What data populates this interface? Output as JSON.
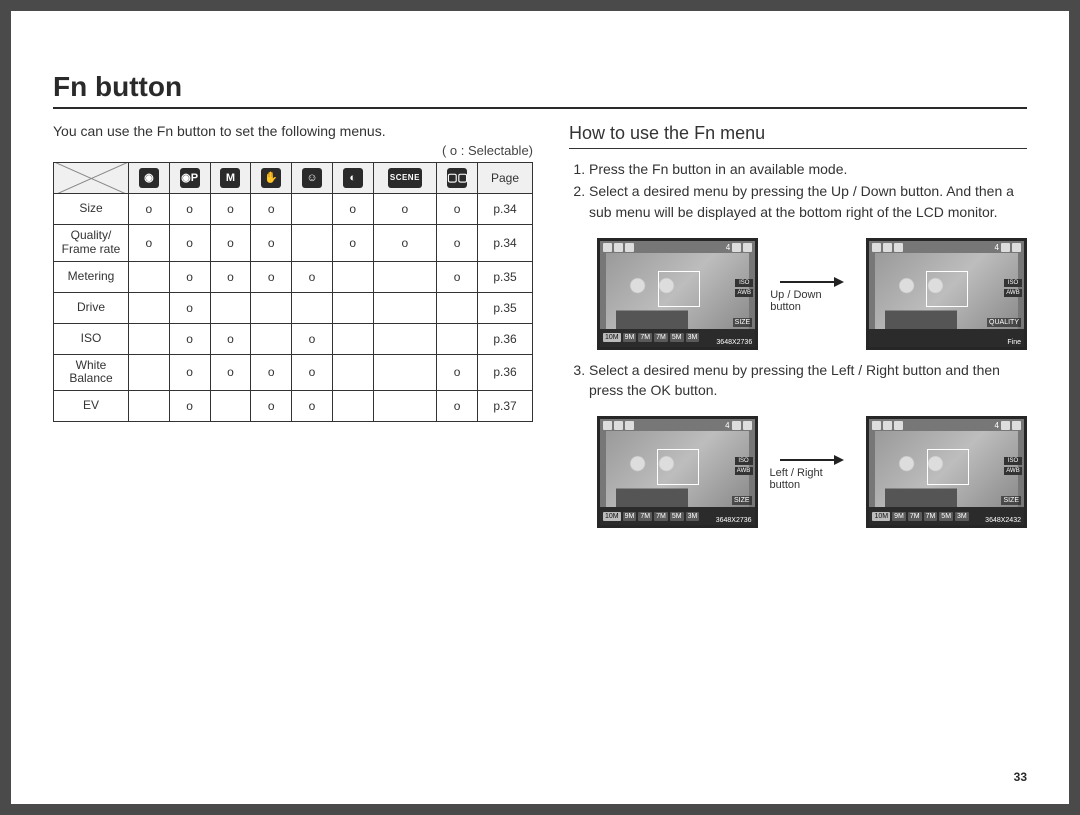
{
  "page_title": "Fn button",
  "intro": "You can use the Fn button to set the following menus.",
  "legend": "( o : Selectable)",
  "table": {
    "header_icons": [
      "camera-auto-icon",
      "camera-p-icon",
      "m-mode-icon",
      "hand-icon",
      "face-icon",
      "night-icon",
      "scene-icon",
      "video-icon"
    ],
    "header_icon_text": [
      "◉",
      "◉P",
      "M",
      "✋",
      "☺",
      "◐",
      "SCENE",
      "▢▢"
    ],
    "page_label": "Page",
    "rows": [
      {
        "label": "Size",
        "cells": [
          "o",
          "o",
          "o",
          "o",
          "",
          "o",
          "o",
          "o"
        ],
        "page": "p.34"
      },
      {
        "label": "Quality/\nFrame rate",
        "cells": [
          "o",
          "o",
          "o",
          "o",
          "",
          "o",
          "o",
          "o"
        ],
        "page": "p.34"
      },
      {
        "label": "Metering",
        "cells": [
          "",
          "o",
          "o",
          "o",
          "o",
          "",
          "",
          "o"
        ],
        "page": "p.35"
      },
      {
        "label": "Drive",
        "cells": [
          "",
          "o",
          "",
          "",
          "",
          "",
          "",
          ""
        ],
        "page": "p.35"
      },
      {
        "label": "ISO",
        "cells": [
          "",
          "o",
          "o",
          "",
          "o",
          "",
          "",
          ""
        ],
        "page": "p.36"
      },
      {
        "label": "White\nBalance",
        "cells": [
          "",
          "o",
          "o",
          "o",
          "o",
          "",
          "",
          "o"
        ],
        "page": "p.36"
      },
      {
        "label": "EV",
        "cells": [
          "",
          "o",
          "",
          "o",
          "o",
          "",
          "",
          "o"
        ],
        "page": "p.37"
      }
    ]
  },
  "subheading": "How to use the Fn menu",
  "steps": [
    "Press the Fn button in an available mode.",
    "Select a desired menu by pressing the Up / Down button. And then a sub menu will be displayed at the bottom right of the LCD monitor.",
    "Select a desired menu by pressing the Left / Right button and then press the OK button."
  ],
  "arrow_labels": {
    "row1": "Up / Down button",
    "row2": "Left / Right button"
  },
  "screens": {
    "a": {
      "side_label": "SIZE",
      "bottom_label": "3648X2736",
      "chips": [
        "10M",
        "9M",
        "7M",
        "7M",
        "5M",
        "3M"
      ],
      "badges": [
        "ISO",
        "AWB"
      ],
      "top_count": "4"
    },
    "b": {
      "side_label": "QUALITY",
      "bottom_label": "Fine",
      "chips": [],
      "badges": [
        "ISO",
        "AWB"
      ],
      "top_count": "4"
    },
    "c": {
      "side_label": "SIZE",
      "bottom_label": "3648X2736",
      "chips": [
        "10M",
        "9M",
        "7M",
        "7M",
        "5M",
        "3M"
      ],
      "badges": [
        "ISO",
        "AWB"
      ],
      "top_count": "4"
    },
    "d": {
      "side_label": "SIZE",
      "bottom_label": "3648X2432",
      "chips": [
        "10M",
        "9M",
        "7M",
        "7M",
        "5M",
        "3M"
      ],
      "badges": [
        "ISO",
        "AWB"
      ],
      "top_count": "4"
    }
  },
  "page_number": "33"
}
